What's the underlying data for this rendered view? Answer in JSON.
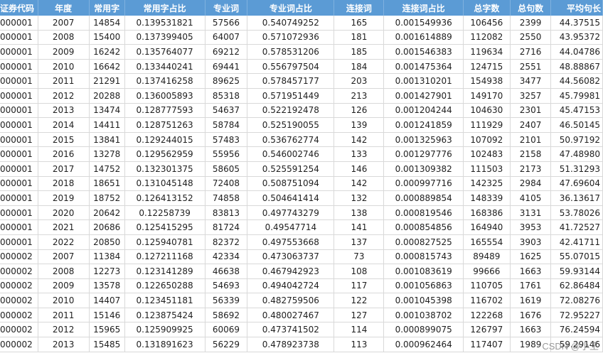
{
  "columns": [
    "证券代码",
    "年度",
    "常用字",
    "常用字占比",
    "专业词",
    "专业词占比",
    "连接词",
    "连接词占比",
    "总字数",
    "总句数",
    "平均句长"
  ],
  "rows": [
    [
      "000001",
      "2007",
      "14854",
      "0.139531821",
      "57566",
      "0.540749252",
      "165",
      "0.001549936",
      "106456",
      "2399",
      "44.37515"
    ],
    [
      "000001",
      "2008",
      "15400",
      "0.137399405",
      "64007",
      "0.571072936",
      "181",
      "0.001614889",
      "112082",
      "2550",
      "43.95372"
    ],
    [
      "000001",
      "2009",
      "16242",
      "0.135764077",
      "69212",
      "0.578531206",
      "185",
      "0.001546383",
      "119634",
      "2716",
      "44.04786"
    ],
    [
      "000001",
      "2010",
      "16642",
      "0.133440241",
      "69441",
      "0.556797504",
      "184",
      "0.001475364",
      "124715",
      "2551",
      "48.88867"
    ],
    [
      "000001",
      "2011",
      "21291",
      "0.137416258",
      "89625",
      "0.578457177",
      "203",
      "0.001310201",
      "154938",
      "3477",
      "44.56082"
    ],
    [
      "000001",
      "2012",
      "20288",
      "0.136005893",
      "85318",
      "0.571951449",
      "213",
      "0.001427901",
      "149170",
      "3257",
      "45.79981"
    ],
    [
      "000001",
      "2013",
      "13474",
      "0.128777593",
      "54637",
      "0.522192478",
      "126",
      "0.001204244",
      "104630",
      "2301",
      "45.47153"
    ],
    [
      "000001",
      "2014",
      "14411",
      "0.128751263",
      "58784",
      "0.525190055",
      "139",
      "0.001241859",
      "111929",
      "2407",
      "46.50145"
    ],
    [
      "000001",
      "2015",
      "13841",
      "0.129244015",
      "57483",
      "0.536762774",
      "142",
      "0.001325963",
      "107092",
      "2101",
      "50.97192"
    ],
    [
      "000001",
      "2016",
      "13278",
      "0.129562959",
      "55956",
      "0.546002746",
      "133",
      "0.001297776",
      "102483",
      "2158",
      "47.48980"
    ],
    [
      "000001",
      "2017",
      "14752",
      "0.132301375",
      "58605",
      "0.525591254",
      "146",
      "0.001309382",
      "111503",
      "2173",
      "51.31293"
    ],
    [
      "000001",
      "2018",
      "18651",
      "0.131045148",
      "72408",
      "0.508751094",
      "142",
      "0.000997716",
      "142325",
      "2984",
      "47.69604"
    ],
    [
      "000001",
      "2019",
      "18752",
      "0.126413152",
      "74858",
      "0.504641414",
      "132",
      "0.000889854",
      "148339",
      "4105",
      "36.13617"
    ],
    [
      "000001",
      "2020",
      "20642",
      "0.12258739",
      "83813",
      "0.497743279",
      "138",
      "0.000819546",
      "168386",
      "3131",
      "53.78026"
    ],
    [
      "000001",
      "2021",
      "20686",
      "0.125415295",
      "81724",
      "0.49547714",
      "141",
      "0.000854856",
      "164940",
      "3953",
      "41.72527"
    ],
    [
      "000001",
      "2022",
      "20850",
      "0.125940781",
      "82372",
      "0.497553668",
      "137",
      "0.000827525",
      "165554",
      "3903",
      "42.41711"
    ],
    [
      "000002",
      "2007",
      "11384",
      "0.127211168",
      "42334",
      "0.473063737",
      "73",
      "0.000815743",
      "89489",
      "1625",
      "55.07015"
    ],
    [
      "000002",
      "2008",
      "12273",
      "0.123141289",
      "46638",
      "0.467942923",
      "108",
      "0.001083619",
      "99666",
      "1663",
      "59.93144"
    ],
    [
      "000002",
      "2009",
      "13578",
      "0.122650288",
      "54693",
      "0.494042724",
      "117",
      "0.001056863",
      "110705",
      "1761",
      "62.86484"
    ],
    [
      "000002",
      "2010",
      "14407",
      "0.123451181",
      "56339",
      "0.482759506",
      "122",
      "0.001045398",
      "116702",
      "1619",
      "72.08276"
    ],
    [
      "000002",
      "2011",
      "15146",
      "0.123875424",
      "58692",
      "0.480027467",
      "127",
      "0.001038702",
      "122268",
      "1676",
      "72.95227"
    ],
    [
      "000002",
      "2012",
      "15965",
      "0.125909925",
      "60069",
      "0.473741502",
      "114",
      "0.000899075",
      "126797",
      "1663",
      "76.24594"
    ],
    [
      "000002",
      "2013",
      "15485",
      "0.131891623",
      "56229",
      "0.478923738",
      "113",
      "0.000962464",
      "117407",
      "1989",
      "59.29146"
    ]
  ],
  "watermark": "CSDN @小王"
}
